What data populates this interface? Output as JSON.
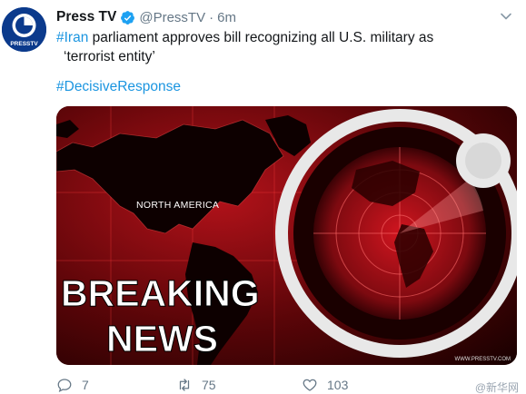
{
  "tweet": {
    "display_name": "Press TV",
    "handle": "@PressTV",
    "separator": "·",
    "time": "6m",
    "text_hashtag": "#Iran",
    "text_line1": " parliament approves bill recognizing all U.S. military as",
    "text_line2": "‘terrorist entity’",
    "hashtag_line": "#DecisiveResponse"
  },
  "avatar": {
    "logo_text": "PRESSTV"
  },
  "media": {
    "headline_line1": "BREAKING",
    "headline_line2": "NEWS",
    "map_label": "NORTH AMERICA",
    "credit": "WWW.PRESSTV.COM"
  },
  "actions": {
    "replies": "7",
    "retweets": "75",
    "likes": "103"
  },
  "watermark": "@新华网",
  "colors": {
    "link": "#1b95e0",
    "muted": "#657786",
    "brand": "#0b3a8c",
    "breaking_red": "#c8101a"
  }
}
